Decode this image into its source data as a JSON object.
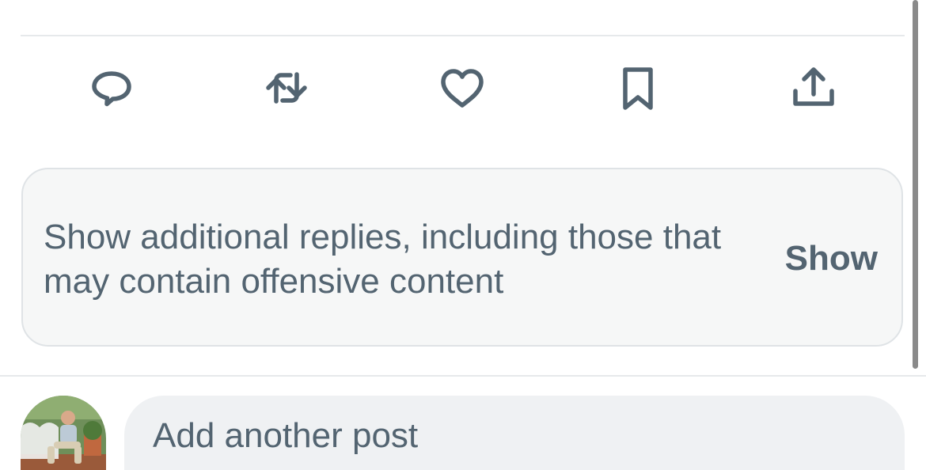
{
  "actions": {
    "reply_icon": "reply-icon",
    "repost_icon": "repost-icon",
    "like_icon": "heart-icon",
    "bookmark_icon": "bookmark-icon",
    "share_icon": "share-icon"
  },
  "additional_replies": {
    "message": "Show additional replies, including those that may contain offensive content",
    "show_label": "Show"
  },
  "composer": {
    "placeholder": "Add another post"
  },
  "colors": {
    "icon": "#536471",
    "card_bg": "#f6f7f7",
    "card_border": "#dfe3e6",
    "input_bg": "#eff1f3"
  }
}
